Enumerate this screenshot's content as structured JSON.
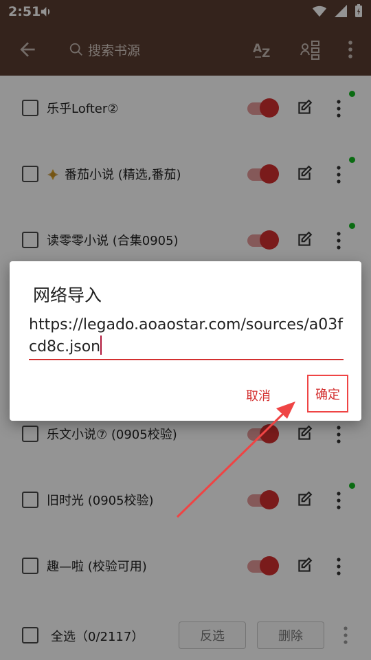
{
  "status_bar": {
    "time": "2:51"
  },
  "toolbar": {
    "search_placeholder": "搜索书源"
  },
  "sources": [
    {
      "name": "乐乎Lofter②",
      "badge": false
    },
    {
      "name": "番茄小说 (精选,番茄)",
      "badge": true
    },
    {
      "name": "读零零小说 (合集0905)",
      "badge": false
    },
    {
      "name": "",
      "badge": false
    },
    {
      "name": "",
      "badge": false
    },
    {
      "name": "乐文小说⑦ (0905校验)",
      "badge": false
    },
    {
      "name": "旧时光 (0905校验)",
      "badge": false
    },
    {
      "name": "趣—啦 (校验可用)",
      "badge": false
    }
  ],
  "bottom_bar": {
    "select_all": "全选（0/2117）",
    "invert_label": "反选",
    "delete_label": "删除"
  },
  "dialog": {
    "title": "网络导入",
    "url_value": "https://legado.aoaostar.com/sources/a03fcd8c.json",
    "cancel_label": "取消",
    "ok_label": "确定"
  },
  "colors": {
    "toolbar": "#5a3d31",
    "accent": "#d32f2f",
    "highlight": "#ef4444",
    "dot": "#12b81f"
  }
}
